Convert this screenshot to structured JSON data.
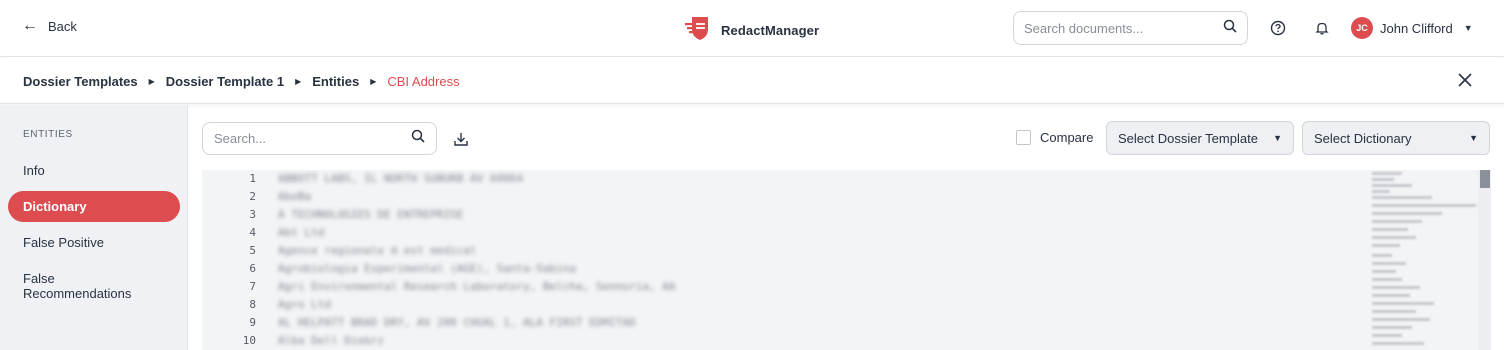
{
  "header": {
    "back_label": "Back",
    "brand_name": "RedactManager",
    "search_placeholder": "Search documents...",
    "user_initials": "JC",
    "user_name": "John Clifford"
  },
  "breadcrumb": {
    "items": [
      "Dossier Templates",
      "Dossier Template 1",
      "Entities",
      "CBI Address"
    ]
  },
  "sidebar": {
    "title": "ENTITIES",
    "items": [
      {
        "label": "Info",
        "active": false
      },
      {
        "label": "Dictionary",
        "active": true
      },
      {
        "label": "False Positive",
        "active": false
      },
      {
        "label": "False Recommendations",
        "active": false
      }
    ]
  },
  "toolbar": {
    "search_placeholder": "Search...",
    "compare_label": "Compare",
    "compare_checked": false,
    "select_template_label": "Select Dossier Template",
    "select_dictionary_label": "Select Dictionary"
  },
  "editor": {
    "line_numbers": [
      "1",
      "2",
      "3",
      "4",
      "5",
      "6",
      "7",
      "8",
      "9",
      "10"
    ],
    "lines": [
      "ABBOTT LABS, IL NORTH SUBURB AV 60064",
      "AbeBa",
      "A TECHNOLOGIES DE ENTREPRISE",
      "Abt Ltd",
      "Agence regionale d est medical",
      "Agrobiologia Experimental (AGE), Santa-Sabina",
      "Agri Environmental Research Laboratory, Belcha, Sennoria, AA",
      "Agro Ltd",
      "AL HELPATT BRAD DRY, AV 200 CHUAL 1, ALA FIRST EDMITAD",
      "Alba Dell Diebrz"
    ]
  },
  "colors": {
    "accent": "#dd4d50",
    "text": "#283241",
    "sidebar_bg": "#f0f1f4",
    "editor_bg": "#f3f4f6"
  }
}
